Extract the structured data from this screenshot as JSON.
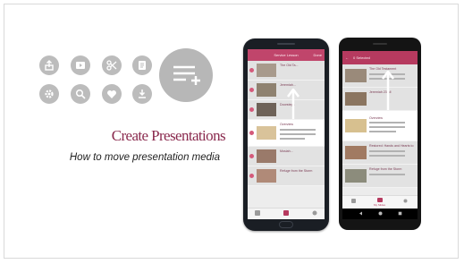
{
  "slide": {
    "title": "Create Presentations",
    "subtitle": "How to move presentation media"
  },
  "icons": [
    "upload-icon",
    "video-icon",
    "scissors-icon",
    "document-icon",
    "gear-icon",
    "search-icon",
    "heart-icon",
    "download-icon"
  ],
  "feature_icon": "playlist-add-icon",
  "iphone": {
    "header_title": "Service Lesson",
    "header_done": "Done",
    "rows": [
      {
        "label": "The Old Ta..."
      },
      {
        "label": "Jeremiah..."
      },
      {
        "label": "Doorsteps"
      },
      {
        "label": "Overview"
      },
      {
        "label": "Mosiah..."
      },
      {
        "label": "Refuge from the Storm"
      }
    ],
    "highlighted_index": 3
  },
  "android": {
    "header_title": "0 Selected",
    "rows": [
      {
        "label": "The Old Testament"
      },
      {
        "label": "Jeremiah 23 all"
      },
      {
        "label": "Overview"
      },
      {
        "label": "Restored: Hands and Hearts to Lead the Work"
      },
      {
        "label": "Refuge from the Storm"
      }
    ],
    "highlighted_index": 2,
    "bottom_tab_label": "My Slides"
  },
  "colors": {
    "accent": "#8a2a4e",
    "appbar": "#c0456b",
    "icon_bg": "#bcbcbc"
  }
}
